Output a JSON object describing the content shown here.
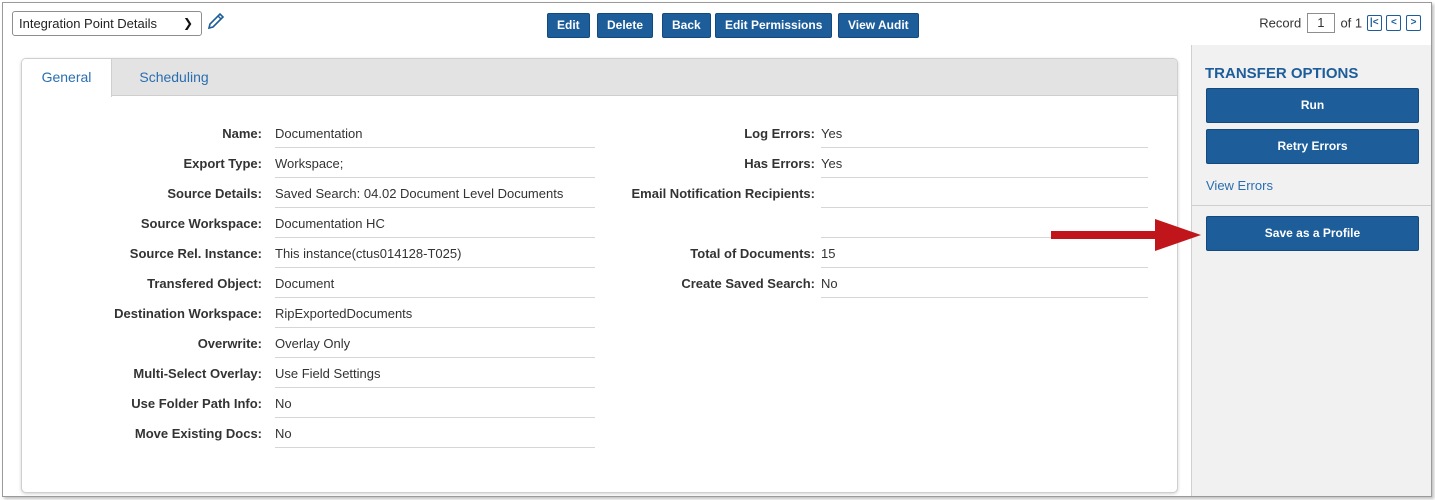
{
  "toolbar": {
    "view_select": "Integration Point Details",
    "buttons": {
      "edit": "Edit",
      "delete": "Delete",
      "back": "Back",
      "edit_permissions": "Edit Permissions",
      "view_audit": "View Audit"
    },
    "record": {
      "label": "Record",
      "current": "1",
      "of_label": "of 1"
    }
  },
  "tabs": {
    "general": "General",
    "scheduling": "Scheduling"
  },
  "left_fields": [
    {
      "label": "Name:",
      "value": "Documentation"
    },
    {
      "label": "Export Type:",
      "value": "Workspace;"
    },
    {
      "label": "Source Details:",
      "value": "Saved Search: 04.02 Document Level Documents"
    },
    {
      "label": "Source Workspace:",
      "value": "Documentation HC"
    },
    {
      "label": "Source Rel. Instance:",
      "value": "This instance(ctus014128-T025)"
    },
    {
      "label": "Transfered Object:",
      "value": "Document"
    },
    {
      "label": "Destination Workspace:",
      "value": "RipExportedDocuments"
    },
    {
      "label": "Overwrite:",
      "value": "Overlay Only"
    },
    {
      "label": "Multi-Select Overlay:",
      "value": "Use Field Settings"
    },
    {
      "label": "Use Folder Path Info:",
      "value": "No"
    },
    {
      "label": "Move Existing Docs:",
      "value": "No"
    }
  ],
  "right_fields": [
    {
      "label": "Log Errors:",
      "value": "Yes"
    },
    {
      "label": "Has Errors:",
      "value": "Yes"
    },
    {
      "label": "Email Notification Recipients:",
      "value": ""
    },
    {
      "label": "",
      "value": ""
    },
    {
      "label": "Total of Documents:",
      "value": "15"
    },
    {
      "label": "Create Saved Search:",
      "value": "No"
    }
  ],
  "sidebar": {
    "title": "TRANSFER OPTIONS",
    "run": "Run",
    "retry_errors": "Retry Errors",
    "view_errors": "View Errors",
    "save_profile": "Save as a Profile"
  },
  "colors": {
    "primary": "#1c5d9a",
    "link": "#2a6eb0",
    "arrow": "#c0161b",
    "tab_bg": "#e3e3e3",
    "sidebar_bg": "#f1f1f1"
  }
}
